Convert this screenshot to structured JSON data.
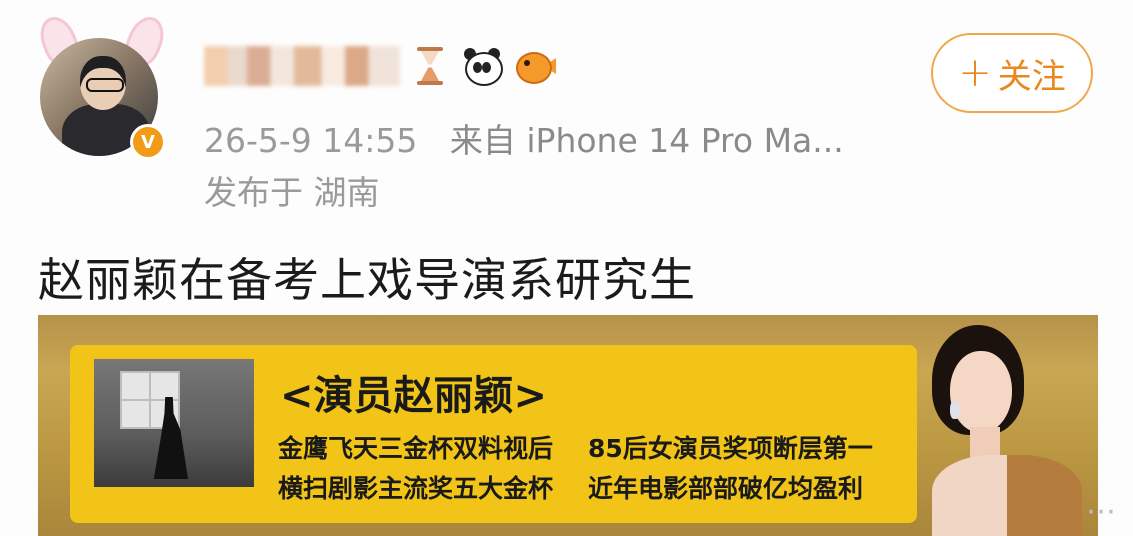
{
  "post": {
    "meta": {
      "timestamp": "26-5-9 14:55",
      "source": "来自 iPhone 14 Pro Ma...",
      "location": "发布于 湖南"
    },
    "text": "赵丽颖在备考上戏导演系研究生",
    "follow_label": "关注",
    "follow_plus": "+"
  },
  "banner": {
    "title": "<演员赵丽颖>",
    "line1_left": "金鹰飞天三金杯双料视后",
    "line2_left": "横扫剧影主流奖五大金杯",
    "line1_right": "85后女演员奖项断层第一",
    "line2_right": "近年电影部部破亿均盈利"
  },
  "ui": {
    "verified": "V",
    "more": "⋯"
  },
  "colors": {
    "accent": "#e8891f",
    "verified_badge": "#f29b16",
    "banner_panel": "#f2c417"
  },
  "icons": [
    "hourglass-icon",
    "panda-icon",
    "fish-icon"
  ]
}
